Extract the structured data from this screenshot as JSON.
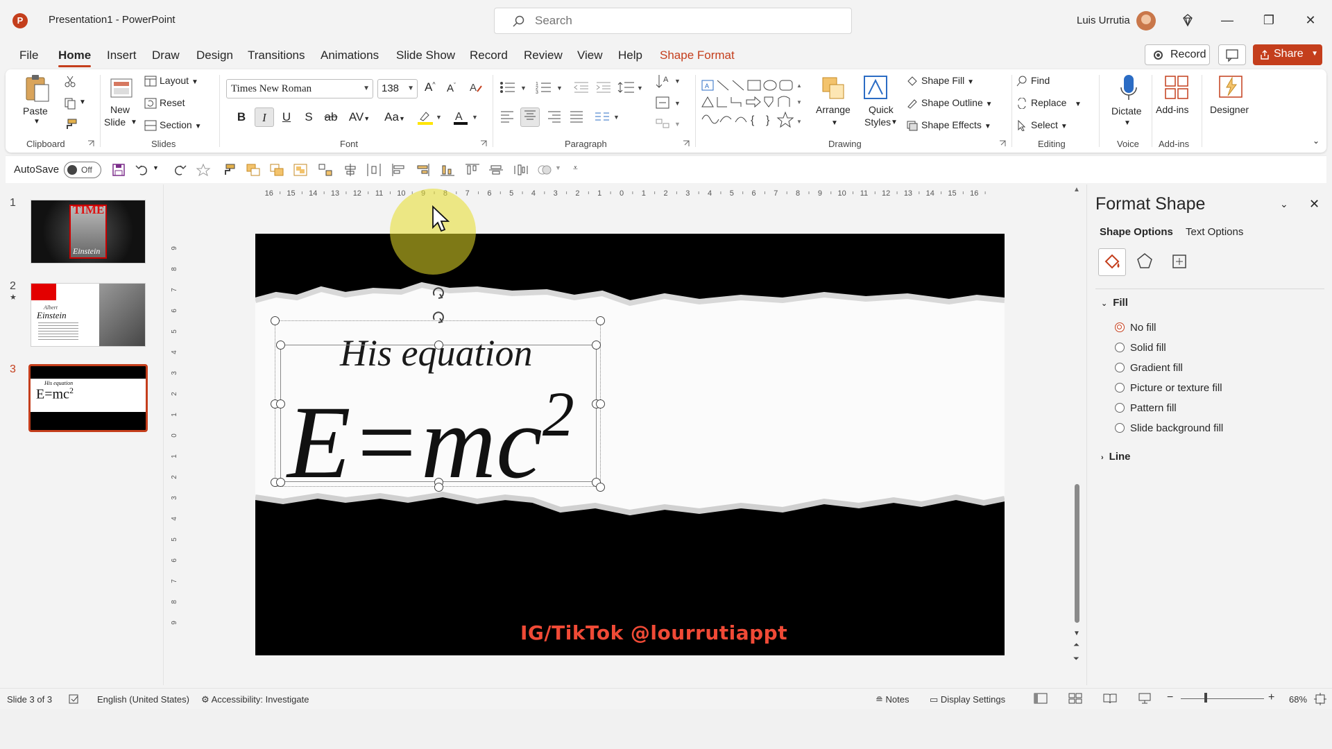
{
  "app": {
    "logo_letter": "P",
    "title": "Presentation1  -  PowerPoint",
    "user_name": "Luis Urrutia"
  },
  "search": {
    "placeholder": "Search"
  },
  "window_controls": {
    "minimize": "—",
    "restore": "❐",
    "close": "✕"
  },
  "tabs": [
    "File",
    "Home",
    "Insert",
    "Draw",
    "Design",
    "Transitions",
    "Animations",
    "Slide Show",
    "Record",
    "Review",
    "View",
    "Help",
    "Shape Format"
  ],
  "active_tab": "Home",
  "header_buttons": {
    "record": "Record",
    "share": "Share"
  },
  "ribbon": {
    "clipboard": {
      "paste": "Paste",
      "label": "Clipboard"
    },
    "slides": {
      "new_slide": "New",
      "new_slide2": "Slide",
      "layout": "Layout",
      "reset": "Reset",
      "section": "Section",
      "label": "Slides"
    },
    "font": {
      "name": "Times New Roman",
      "size": "138",
      "label": "Font"
    },
    "paragraph": {
      "label": "Paragraph"
    },
    "drawing": {
      "arrange": "Arrange",
      "quick_styles": "Quick",
      "quick_styles2": "Styles",
      "shape_fill": "Shape Fill",
      "shape_outline": "Shape Outline",
      "shape_effects": "Shape Effects",
      "label": "Drawing"
    },
    "editing": {
      "find": "Find",
      "replace": "Replace",
      "select": "Select",
      "label": "Editing"
    },
    "voice": {
      "dictate": "Dictate",
      "label": "Voice"
    },
    "addins": {
      "addins": "Add-ins",
      "label": "Add-ins"
    },
    "designer": {
      "designer": "Designer"
    }
  },
  "qat": {
    "autosave": "AutoSave",
    "toggle": "Off"
  },
  "slides": [
    {
      "num": "1",
      "title": "TIME",
      "caption": "Einstein"
    },
    {
      "num": "2",
      "star": "★",
      "title": "Albert",
      "title2": "Einstein"
    },
    {
      "num": "3",
      "title": "His equation",
      "title2": "E=mc",
      "sup": "2"
    }
  ],
  "slide": {
    "heading": "His equation",
    "equation": "E=mc",
    "superscript": "2",
    "watermark": "IG/TikTok @lourrutiappt"
  },
  "ruler_h": [
    "16",
    "15",
    "14",
    "13",
    "12",
    "11",
    "10",
    "9",
    "8",
    "7",
    "6",
    "5",
    "4",
    "3",
    "2",
    "1",
    "0",
    "1",
    "2",
    "3",
    "4",
    "5",
    "6",
    "7",
    "8",
    "9",
    "10",
    "11",
    "12",
    "13",
    "14",
    "15",
    "16"
  ],
  "ruler_v": [
    "9",
    "8",
    "7",
    "6",
    "5",
    "4",
    "3",
    "2",
    "1",
    "0",
    "1",
    "2",
    "3",
    "4",
    "5",
    "6",
    "7",
    "8",
    "9"
  ],
  "pane": {
    "title": "Format Shape",
    "tab_shape": "Shape Options",
    "tab_text": "Text Options",
    "fill_header": "Fill",
    "line_header": "Line",
    "fill_options": [
      "No fill",
      "Solid fill",
      "Gradient fill",
      "Picture or texture fill",
      "Pattern fill",
      "Slide background fill"
    ],
    "selected_fill": "No fill"
  },
  "status": {
    "slide_count": "Slide 3 of 3",
    "language": "English (United States)",
    "accessibility": "Accessibility: Investigate",
    "notes": "Notes",
    "display": "Display Settings",
    "zoom": "68%"
  },
  "colors": {
    "accent": "#c43e1c",
    "watermark": "#f04a36",
    "highlight": "#e6dc28"
  }
}
